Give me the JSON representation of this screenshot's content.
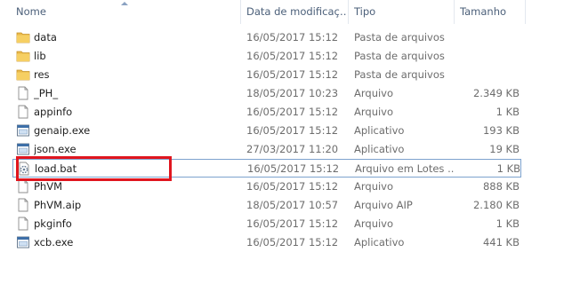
{
  "columns": {
    "name": "Nome",
    "date": "Data de modificaç…",
    "type": "Tipo",
    "size": "Tamanho"
  },
  "files": [
    {
      "name": "data",
      "date": "16/05/2017 15:12",
      "type": "Pasta de arquivos",
      "size": "",
      "icon": "folder-icon"
    },
    {
      "name": "lib",
      "date": "16/05/2017 15:12",
      "type": "Pasta de arquivos",
      "size": "",
      "icon": "folder-icon"
    },
    {
      "name": "res",
      "date": "16/05/2017 15:12",
      "type": "Pasta de arquivos",
      "size": "",
      "icon": "folder-icon"
    },
    {
      "name": "_PH_",
      "date": "18/05/2017 10:23",
      "type": "Arquivo",
      "size": "2.349 KB",
      "icon": "file-icon"
    },
    {
      "name": "appinfo",
      "date": "16/05/2017 15:12",
      "type": "Arquivo",
      "size": "1 KB",
      "icon": "file-icon"
    },
    {
      "name": "genaip.exe",
      "date": "16/05/2017 15:12",
      "type": "Aplicativo",
      "size": "193 KB",
      "icon": "exe-icon"
    },
    {
      "name": "json.exe",
      "date": "27/03/2017 11:20",
      "type": "Aplicativo",
      "size": "19 KB",
      "icon": "exe-icon"
    },
    {
      "name": "load.bat",
      "date": "16/05/2017 15:12",
      "type": "Arquivo em Lotes ...",
      "size": "1 KB",
      "icon": "batch-file-icon",
      "selected": true
    },
    {
      "name": "PhVM",
      "date": "16/05/2017 15:12",
      "type": "Arquivo",
      "size": "888 KB",
      "icon": "file-icon"
    },
    {
      "name": "PhVM.aip",
      "date": "18/05/2017 10:57",
      "type": "Arquivo AIP",
      "size": "2.180 KB",
      "icon": "file-icon"
    },
    {
      "name": "pkginfo",
      "date": "16/05/2017 15:12",
      "type": "Arquivo",
      "size": "1 KB",
      "icon": "file-icon"
    },
    {
      "name": "xcb.exe",
      "date": "16/05/2017 15:12",
      "type": "Aplicativo",
      "size": "441 KB",
      "icon": "exe-icon"
    }
  ],
  "colors": {
    "highlight": "#e0161f",
    "selection_border": "#7da2ce",
    "folder": "#e8b84a",
    "header_text": "#4c607a"
  }
}
